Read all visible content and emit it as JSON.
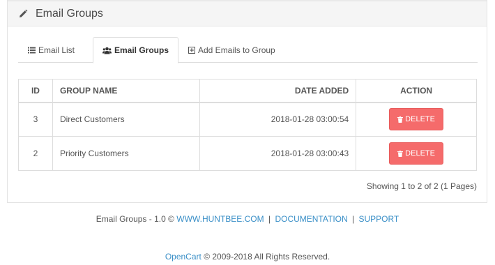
{
  "panel": {
    "title": "Email Groups",
    "pencil_icon": "pencil-icon"
  },
  "tabs": [
    {
      "label": "Email List",
      "icon": "list-icon"
    },
    {
      "label": "Email Groups",
      "icon": "users-icon",
      "active": true
    },
    {
      "label": "Add Emails to Group",
      "icon": "plus-square-icon"
    }
  ],
  "table": {
    "headers": {
      "id": "ID",
      "group_name": "GROUP NAME",
      "date_added": "DATE ADDED",
      "action": "ACTION"
    },
    "rows": [
      {
        "id": "3",
        "group_name": "Direct Customers",
        "date_added": "2018-01-28 03:00:54",
        "action_label": "DELETE"
      },
      {
        "id": "2",
        "group_name": "Priority Customers",
        "date_added": "2018-01-28 03:00:43",
        "action_label": "DELETE"
      }
    ]
  },
  "pagination": {
    "info": "Showing 1 to 2 of 2 (1 Pages)"
  },
  "footer": {
    "module_prefix": "Email Groups - 1.0 ©",
    "link_huntbee": "WWW.HUNTBEE.COM",
    "link_docs": "DOCUMENTATION",
    "link_support": "SUPPORT",
    "separator": "|",
    "opencart_link": "OpenCart",
    "copyright": "© 2009-2018 All Rights Reserved."
  },
  "colors": {
    "delete_button": "#f56b6b",
    "link": "#3a8fc7"
  }
}
